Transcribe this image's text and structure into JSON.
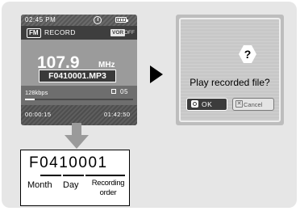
{
  "player": {
    "time": "02:45 PM",
    "clock_icon": "clock-icon",
    "battery_icon": "battery-icon",
    "mode_badge": "FM",
    "mode_label": "RECORD",
    "vor_badge": "VOR",
    "vor_state": "OFF",
    "frequency": "107.9",
    "frequency_unit": "MHz",
    "filename": "F0410001.MP3",
    "bitrate": "128kbps",
    "speaker_icon": "speaker-icon",
    "volume": "05",
    "progress_fraction": 0.09,
    "elapsed": "00:00:15",
    "total": "01:42:50"
  },
  "legend": {
    "code": "F0410001",
    "month_label": "Month",
    "day_label": "Day",
    "order_label": "Recording order"
  },
  "dialog": {
    "icon": "question-icon",
    "message": "Play recorded file?",
    "ok_label": "OK",
    "cancel_label": "Cancel"
  },
  "colors": {
    "panel_bg": "#e6e6e6",
    "arrow": "#9a9a9a",
    "screen_dark": "#3e3e3e"
  }
}
